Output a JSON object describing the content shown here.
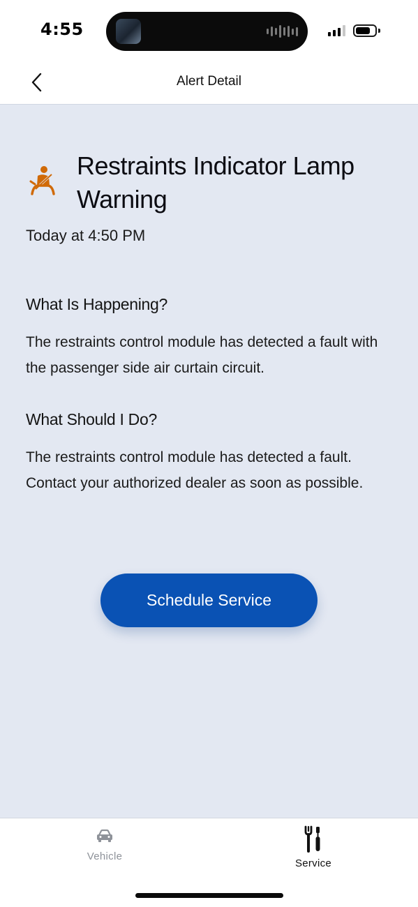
{
  "status_bar": {
    "time": "4:55"
  },
  "header": {
    "title": "Alert Detail",
    "back_icon": "chevron-left-icon"
  },
  "alert": {
    "icon": "seatbelt-warning-icon",
    "icon_color": "#d06a08",
    "title": "Restraints Indicator Lamp Warning",
    "time": "Today at 4:50 PM"
  },
  "sections": [
    {
      "heading": "What Is Happening?",
      "body": "The restraints control module has detected a fault with the passenger side air curtain circuit."
    },
    {
      "heading": "What Should I Do?",
      "body": "The restraints control module has detected a fault. Contact your authorized dealer as soon as possible."
    }
  ],
  "actions": {
    "schedule_label": "Schedule Service",
    "button_color": "#0a52b4"
  },
  "tab_bar": {
    "items": [
      {
        "label": "Vehicle",
        "icon": "car-icon",
        "active": false
      },
      {
        "label": "Service",
        "icon": "tools-icon",
        "active": true
      }
    ]
  },
  "colors": {
    "content_bg": "#e3e8f2",
    "inactive_tab": "#8e9299"
  }
}
